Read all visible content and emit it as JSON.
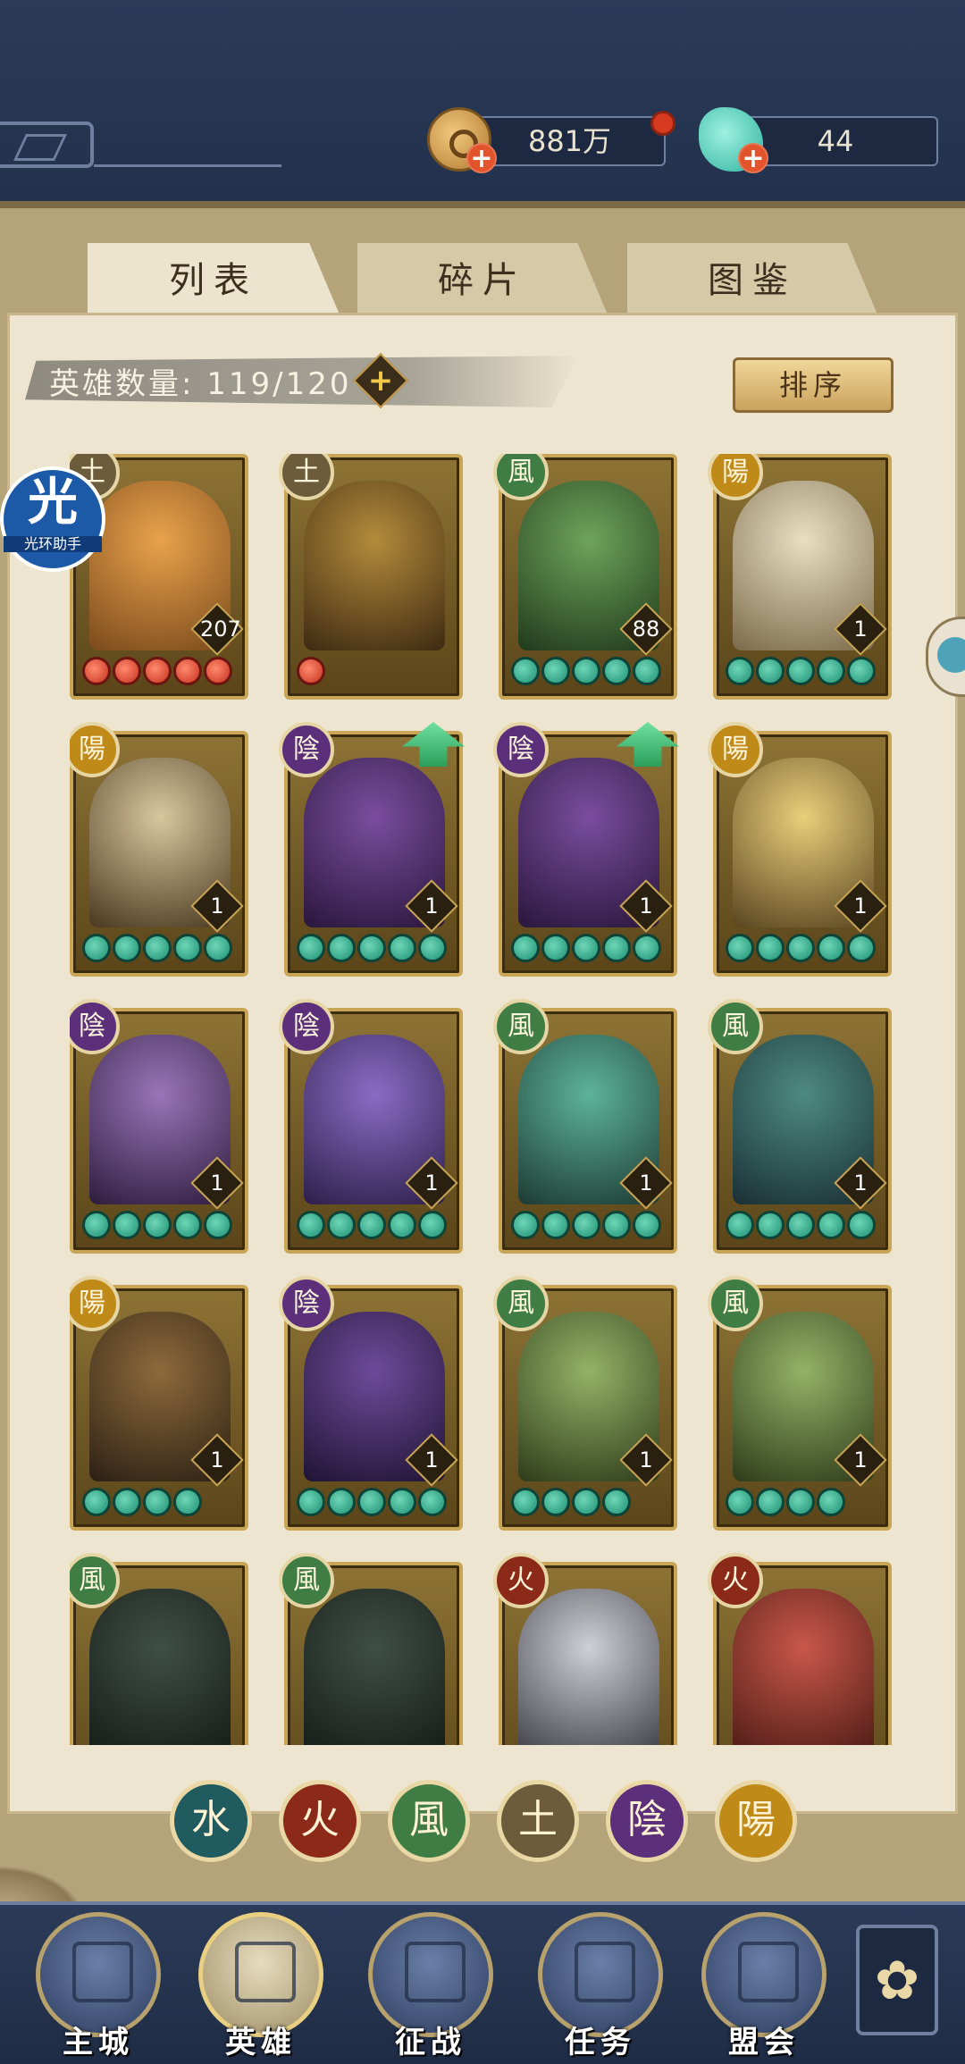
{
  "resources": {
    "coins": "881万",
    "gems": "44",
    "plus_symbol": "+"
  },
  "tabs": [
    {
      "label": "列表",
      "active": true
    },
    {
      "label": "碎片",
      "active": false
    },
    {
      "label": "图鉴",
      "active": false
    }
  ],
  "hero_count": {
    "label": "英雄数量: 119/120",
    "plus": "+"
  },
  "sort_button": "排序",
  "side_bubble": {
    "glyph": "光",
    "caption": "光环助手"
  },
  "heroes": [
    {
      "element": "earth",
      "element_glyph": "土",
      "level": "207",
      "stars": 5,
      "star_color": "red",
      "upgrade": false,
      "art": [
        "#e9a24b",
        "#7a4a1c"
      ]
    },
    {
      "element": "earth",
      "element_glyph": "土",
      "level": "",
      "stars": 1,
      "star_color": "red",
      "upgrade": false,
      "art": [
        "#b38b3b",
        "#3e2a12"
      ]
    },
    {
      "element": "wind",
      "element_glyph": "風",
      "level": "88",
      "stars": 5,
      "star_color": "green",
      "upgrade": false,
      "art": [
        "#6fa35a",
        "#1f3a1c"
      ]
    },
    {
      "element": "yang",
      "element_glyph": "陽",
      "level": "1",
      "stars": 5,
      "star_color": "green",
      "upgrade": false,
      "art": [
        "#e8dfc3",
        "#7b6a4a"
      ]
    },
    {
      "element": "yang",
      "element_glyph": "陽",
      "level": "1",
      "stars": 5,
      "star_color": "green",
      "upgrade": false,
      "art": [
        "#d8c79d",
        "#4a3820"
      ]
    },
    {
      "element": "yin",
      "element_glyph": "陰",
      "level": "1",
      "stars": 5,
      "star_color": "green",
      "upgrade": true,
      "art": [
        "#7a4d9e",
        "#2a163b"
      ]
    },
    {
      "element": "yin",
      "element_glyph": "陰",
      "level": "1",
      "stars": 5,
      "star_color": "green",
      "upgrade": true,
      "art": [
        "#7a4d9e",
        "#2a163b"
      ]
    },
    {
      "element": "yang",
      "element_glyph": "陽",
      "level": "1",
      "stars": 5,
      "star_color": "green",
      "upgrade": false,
      "art": [
        "#e7cf7a",
        "#5a4420"
      ]
    },
    {
      "element": "yin",
      "element_glyph": "陰",
      "level": "1",
      "stars": 5,
      "star_color": "green",
      "upgrade": false,
      "art": [
        "#9a74b8",
        "#2e1d3d"
      ]
    },
    {
      "element": "yin",
      "element_glyph": "陰",
      "level": "1",
      "stars": 5,
      "star_color": "green",
      "upgrade": false,
      "art": [
        "#8a6cc4",
        "#2c1f4a"
      ]
    },
    {
      "element": "wind",
      "element_glyph": "風",
      "level": "1",
      "stars": 5,
      "star_color": "green",
      "upgrade": false,
      "art": [
        "#5db39a",
        "#1d3b33"
      ]
    },
    {
      "element": "wind",
      "element_glyph": "風",
      "level": "1",
      "stars": 5,
      "star_color": "green",
      "upgrade": false,
      "art": [
        "#4d8a80",
        "#1a2f35"
      ]
    },
    {
      "element": "yang",
      "element_glyph": "陽",
      "level": "1",
      "stars": 4,
      "star_color": "green",
      "upgrade": false,
      "art": [
        "#8d6a3b",
        "#2c2014"
      ]
    },
    {
      "element": "yin",
      "element_glyph": "陰",
      "level": "1",
      "stars": 5,
      "star_color": "green",
      "upgrade": false,
      "art": [
        "#6e4a9a",
        "#1f1433"
      ]
    },
    {
      "element": "wind",
      "element_glyph": "風",
      "level": "1",
      "stars": 4,
      "star_color": "green",
      "upgrade": false,
      "art": [
        "#94b367",
        "#2e3b1a"
      ]
    },
    {
      "element": "wind",
      "element_glyph": "風",
      "level": "1",
      "stars": 4,
      "star_color": "green",
      "upgrade": false,
      "art": [
        "#94b367",
        "#2e3b1a"
      ]
    },
    {
      "element": "wind",
      "element_glyph": "風",
      "level": "",
      "stars": 0,
      "star_color": "green",
      "upgrade": false,
      "art": [
        "#3f4f45",
        "#151a16"
      ]
    },
    {
      "element": "wind",
      "element_glyph": "風",
      "level": "",
      "stars": 0,
      "star_color": "green",
      "upgrade": false,
      "art": [
        "#3f4f45",
        "#151a16"
      ]
    },
    {
      "element": "fire",
      "element_glyph": "火",
      "level": "",
      "stars": 0,
      "star_color": "green",
      "upgrade": false,
      "art": [
        "#cfcfd6",
        "#3b3b44"
      ]
    },
    {
      "element": "fire",
      "element_glyph": "火",
      "level": "",
      "stars": 0,
      "star_color": "green",
      "upgrade": false,
      "art": [
        "#c9574a",
        "#4a1a14"
      ]
    }
  ],
  "filters": [
    {
      "id": "water",
      "glyph": "水"
    },
    {
      "id": "fire",
      "glyph": "火"
    },
    {
      "id": "wind",
      "glyph": "風"
    },
    {
      "id": "earth",
      "glyph": "土"
    },
    {
      "id": "yin",
      "glyph": "陰"
    },
    {
      "id": "yang",
      "glyph": "陽"
    }
  ],
  "nav": [
    {
      "label": "主城",
      "active": false
    },
    {
      "label": "英雄",
      "active": true
    },
    {
      "label": "征战",
      "active": false
    },
    {
      "label": "任务",
      "active": false
    },
    {
      "label": "盟会",
      "active": false
    }
  ],
  "more_glyph": "✿"
}
